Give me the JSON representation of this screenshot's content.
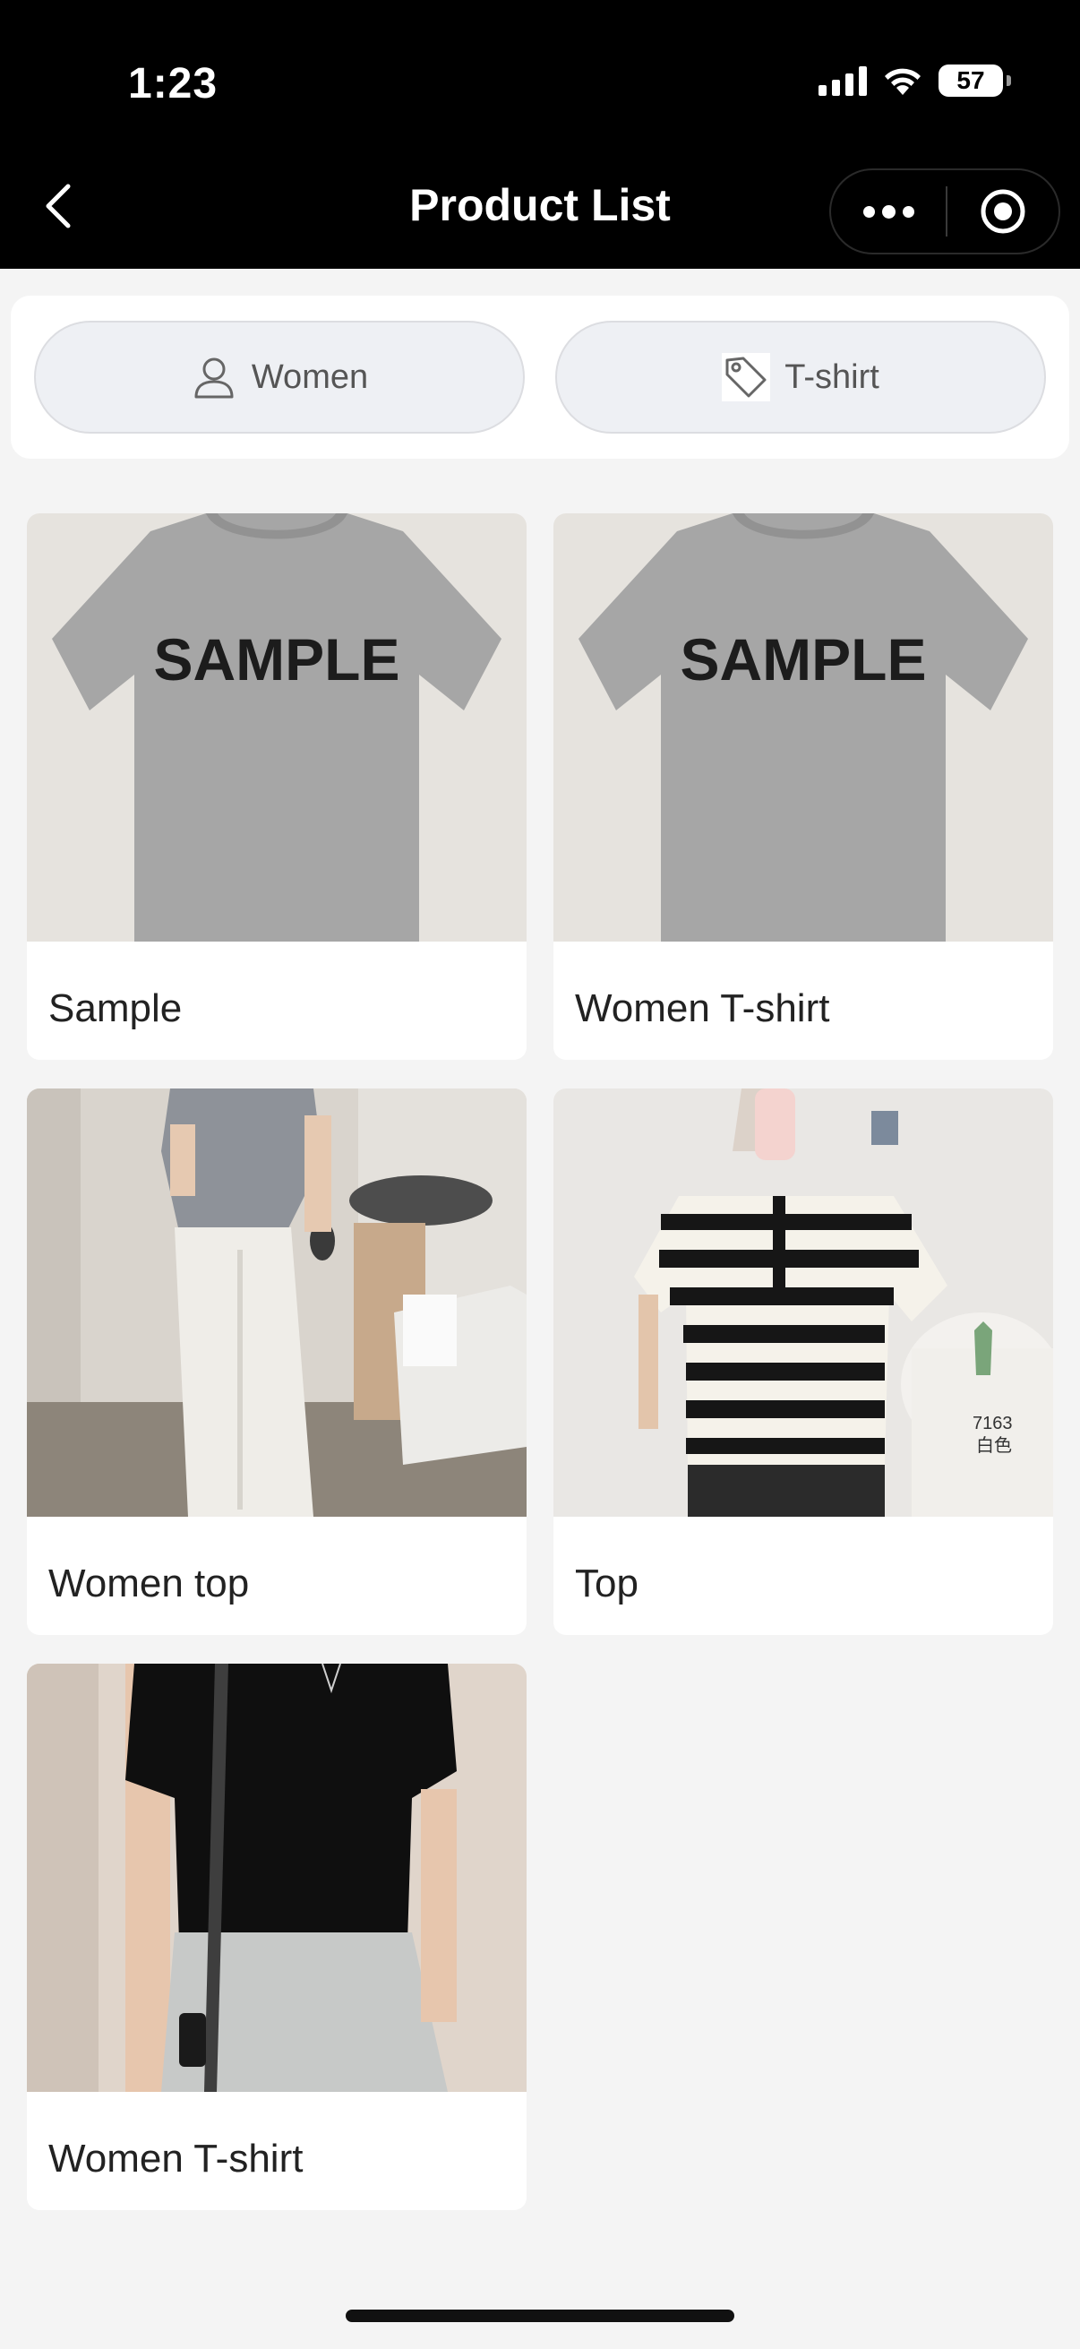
{
  "status_bar": {
    "time": "1:23",
    "battery": "57"
  },
  "nav": {
    "title": "Product List"
  },
  "filters": [
    {
      "label": "Women",
      "icon": "person-icon"
    },
    {
      "label": "T-shirt",
      "icon": "tag-icon"
    }
  ],
  "products": [
    {
      "name": "Sample",
      "image": "grey-tshirt-sample",
      "print_text": "SAMPLE"
    },
    {
      "name": "Women T-shirt",
      "image": "grey-tshirt-sample",
      "print_text": "SAMPLE"
    },
    {
      "name": "Women top",
      "image": "woman-grey-top-white-pants"
    },
    {
      "name": "Top",
      "image": "woman-striped-top",
      "tag_text": "7163",
      "tag_text2": "白色"
    },
    {
      "name": "Women T-shirt",
      "image": "woman-black-tshirt"
    }
  ],
  "colors": {
    "bar": "#000000",
    "background": "#f4f4f4",
    "pill": "#eef0f4"
  }
}
